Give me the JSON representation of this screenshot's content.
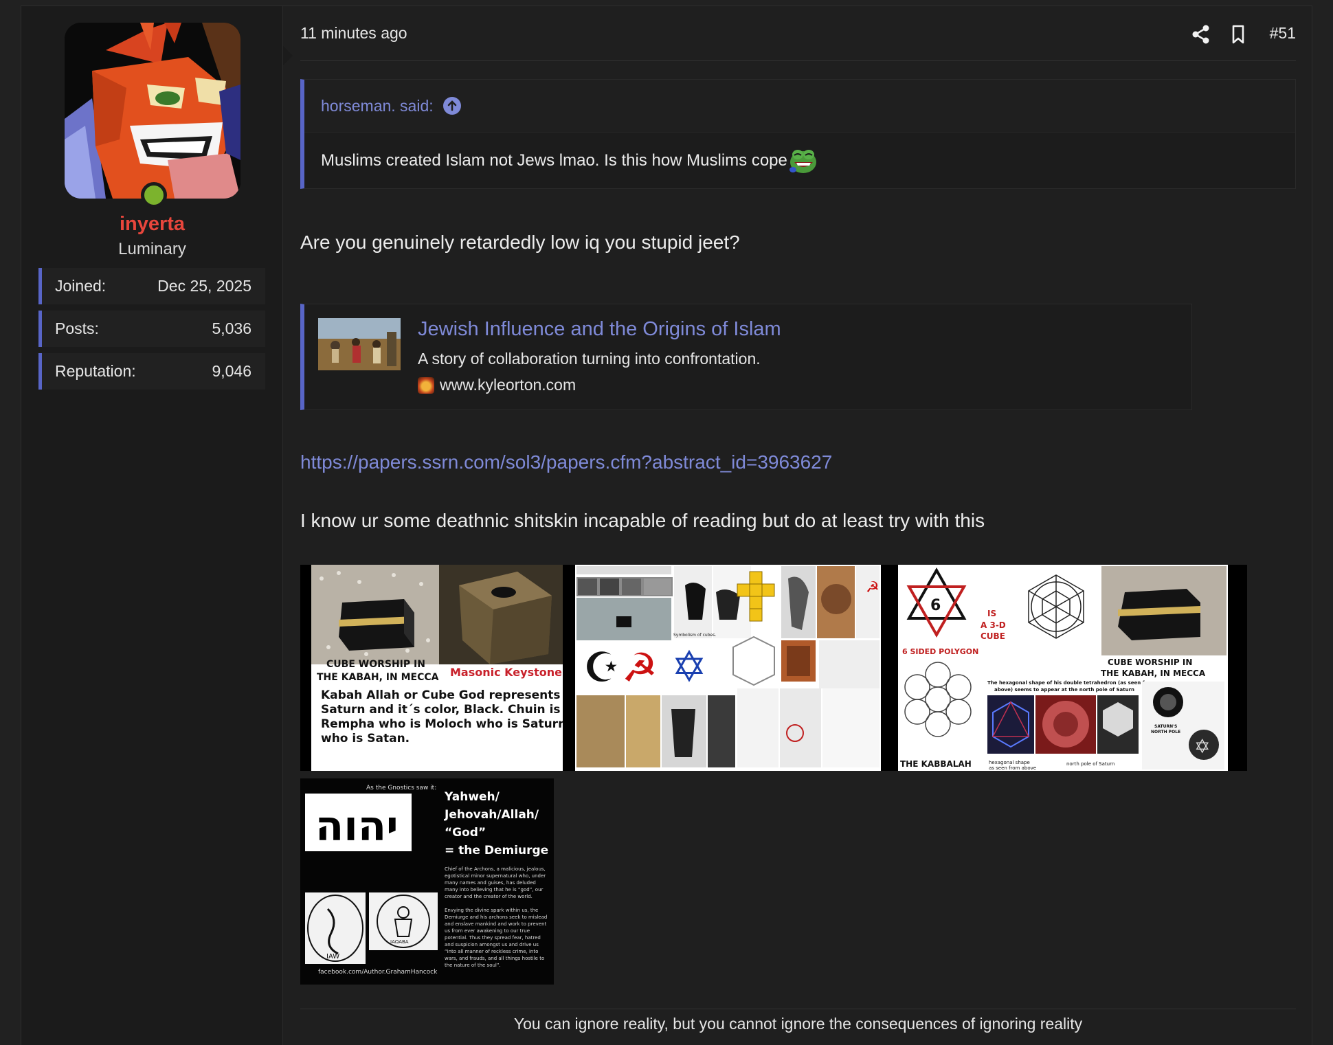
{
  "post": {
    "time": "11 minutes ago",
    "number": "#51",
    "share_icon": "share-icon",
    "bookmark_icon": "bookmark-icon"
  },
  "user": {
    "name": "inyerta",
    "title": "Luminary",
    "online": true,
    "stats": [
      {
        "label": "Joined:",
        "value": "Dec 25, 2025"
      },
      {
        "label": "Posts:",
        "value": "5,036"
      },
      {
        "label": "Reputation:",
        "value": "9,046"
      }
    ]
  },
  "quote": {
    "author": "horseman. said:",
    "text": "Muslims created Islam not Jews lmao. Is this how Muslims cope"
  },
  "body": {
    "line1": "Are you genuinely retardedly low iq you stupid jeet?",
    "line2": "I know ur some deathnic shitskin incapable of reading but do at least try with this",
    "link": "https://papers.ssrn.com/sol3/papers.cfm?abstract_id=3963627"
  },
  "embed": {
    "title": "Jewish Influence and the Origins of Islam",
    "description": "A story of collaboration turning into confrontation.",
    "domain": "www.kyleorton.com"
  },
  "images": {
    "img1": {
      "caption_left": "CUBE WORSHIP IN THE KABAH, IN MECCA",
      "caption_right": "Masonic Keystone",
      "text": "Kabah Allah or Cube God represents Saturn and it´s color, Black. Chuin is Rempha who is Moloch who is Saturn, who is Satan."
    },
    "img2": {
      "caption": "Symbolism of cubes."
    },
    "img3": {
      "polygon_label": "6 SIDED POLYGON",
      "cube_label": "IS A 3-D CUBE",
      "kabah_label": "CUBE WORSHIP IN THE KABAH, IN MECCA",
      "hexagon_text": "The hexagonal shape of his double tetrahedron (as seen from above) seems to appear at the north pole of Saturn",
      "kabbalah_label": "THE KABBALAH",
      "hex_caption": "hexagonal shape as seen from above",
      "north_pole_caption": "north pole of Saturn",
      "saturn_caption": "SATURN'S NORTH POLE",
      "star_number": "6"
    },
    "img4": {
      "top_text": "As the Gnostics saw it:",
      "hebrew": "יהוה",
      "heading1": "Yahweh/",
      "heading2": "Jehovah/Allah/",
      "heading3": "“God”",
      "heading4": "= the Demiurge",
      "para1": "Chief of the Archons, a malicious, jealous, egotistical minor supernatural who, under many names and guises, has deluded many into believing that he is “god”, our creator and the creator of the world.",
      "para2": "Envying the divine spark within us, the Demiurge and his archons seek to mislead and enslave mankind and work to prevent us from ever awakening to our true potential. Thus they spread fear, hatred and suspicion amongst us and drive us “into all manner of reckless crime, into wars, and frauds, and all things hostile to the nature of the soul”.",
      "credit": "facebook.com/Author.GrahamHancock",
      "coin1": "IAW",
      "coin2": "IAΩABA"
    }
  },
  "signature": "You can ignore reality, but you cannot ignore the consequences of ignoring reality",
  "colors": {
    "accent": "#5865c7",
    "link": "#7f8ad8",
    "username": "#e8463c",
    "online": "#7cb32d",
    "background": "#1f1f1f"
  }
}
